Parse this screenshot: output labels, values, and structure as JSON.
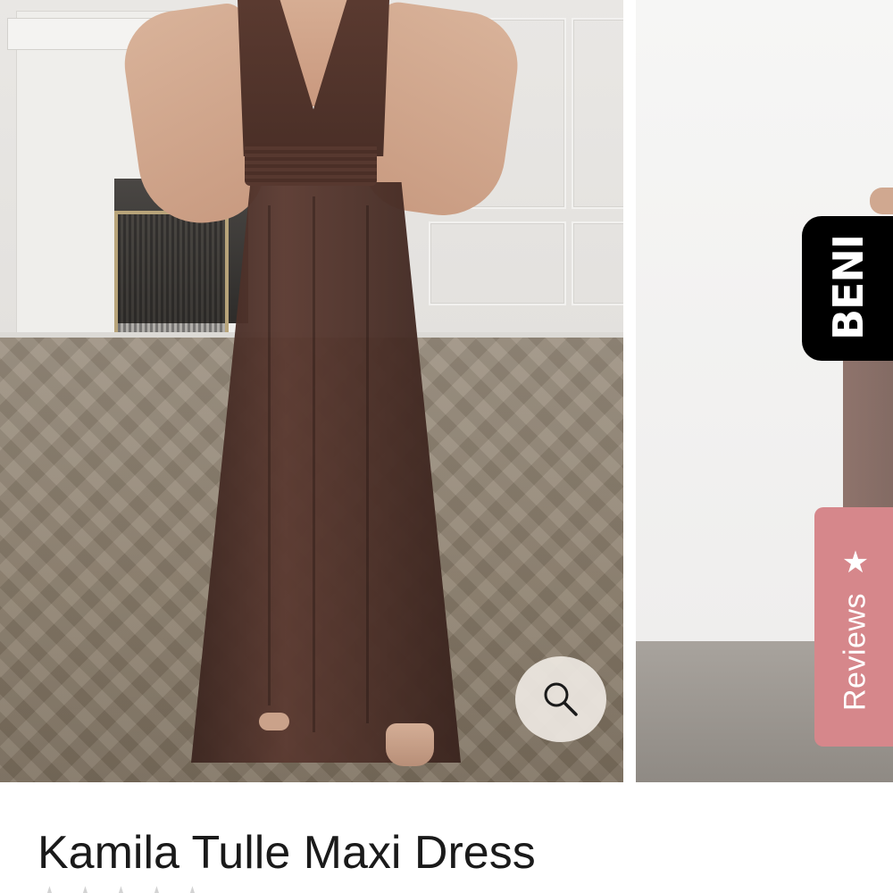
{
  "product": {
    "title": "Kamila Tulle Maxi Dress",
    "rating_stars": 5
  },
  "gallery": {
    "main_image_alt": "Woman wearing brown tulle maxi dress in front of fireplace",
    "second_image_alt": "Brown tulle maxi dress alternate view",
    "zoom_icon": "search-icon"
  },
  "brand_tab": {
    "label": "BENI"
  },
  "reviews_tab": {
    "label": "Reviews",
    "icon": "star-icon",
    "color": "#d6878b"
  },
  "colors": {
    "dress": "#4a2f27",
    "brand_tab_bg": "#000000",
    "reviews_tab_bg": "#d6878b"
  }
}
